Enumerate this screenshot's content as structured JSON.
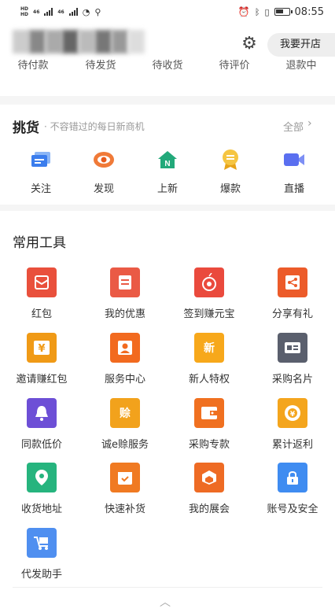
{
  "status_bar": {
    "time": "08:55",
    "net1": "46",
    "net2": "46"
  },
  "header": {
    "open_shop": "我要开店"
  },
  "orders": [
    "待付款",
    "待发货",
    "待收货",
    "待评价",
    "退款中"
  ],
  "pick": {
    "title": "挑货",
    "subtitle": "· 不容错过的每日新商机",
    "all": "全部",
    "items": [
      "关注",
      "发现",
      "上新",
      "爆款",
      "直播"
    ]
  },
  "tools": {
    "title": "常用工具",
    "items": [
      {
        "label": "红包",
        "color": "#e9503c",
        "glyph": ""
      },
      {
        "label": "我的优惠",
        "color": "#ea5a45",
        "glyph": ""
      },
      {
        "label": "签到赚元宝",
        "color": "#ea4a3d",
        "glyph": ""
      },
      {
        "label": "分享有礼",
        "color": "#ec5b2a",
        "glyph": ""
      },
      {
        "label": "邀请赚红包",
        "color": "#f09a16",
        "glyph": ""
      },
      {
        "label": "服务中心",
        "color": "#f26a1f",
        "glyph": ""
      },
      {
        "label": "新人特权",
        "color": "#f7a81b",
        "glyph": "新"
      },
      {
        "label": "采购名片",
        "color": "#5a5f6d",
        "glyph": ""
      },
      {
        "label": "同款低价",
        "color": "#6d4fd6",
        "glyph": ""
      },
      {
        "label": "诚e赊服务",
        "color": "#f2a21c",
        "glyph": "赊"
      },
      {
        "label": "采购专款",
        "color": "#f07020",
        "glyph": ""
      },
      {
        "label": "累计返利",
        "color": "#f4a51d",
        "glyph": ""
      },
      {
        "label": "收货地址",
        "color": "#26b47e",
        "glyph": ""
      },
      {
        "label": "快速补货",
        "color": "#f07a22",
        "glyph": ""
      },
      {
        "label": "我的展会",
        "color": "#ee6b24",
        "glyph": ""
      },
      {
        "label": "账号及安全",
        "color": "#3f8cf1",
        "glyph": ""
      },
      {
        "label": "代发助手",
        "color": "#4f8ff0",
        "glyph": ""
      }
    ]
  }
}
